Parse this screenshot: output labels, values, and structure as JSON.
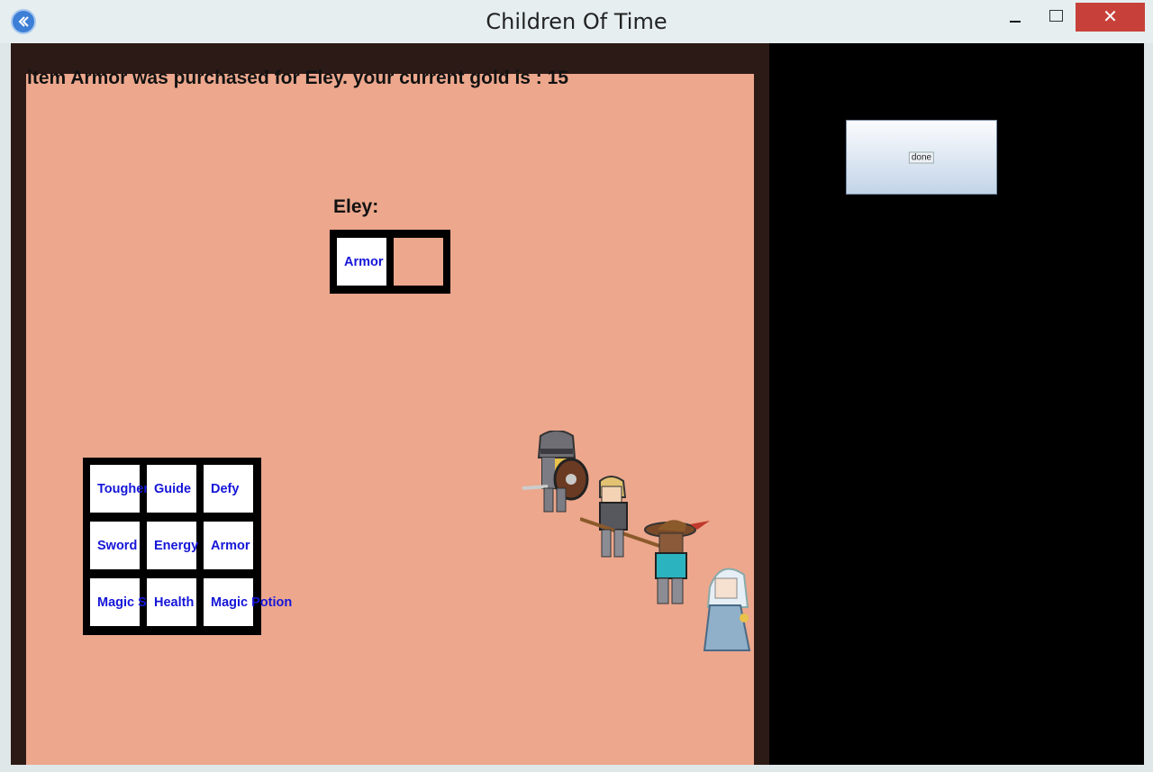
{
  "window": {
    "title": "Children Of Time",
    "close_glyph": "✕"
  },
  "status_message": "item Armor was purchased for Eley. your current gold is : 15",
  "hero": {
    "name": "Eley:",
    "inventory": [
      "Armor",
      ""
    ]
  },
  "shop": {
    "items": [
      [
        "Tougher",
        "Guide",
        "Defy"
      ],
      [
        "Sword",
        "Energy",
        "Armor"
      ],
      [
        "Magic S",
        "Health",
        "Magic Potion"
      ]
    ]
  },
  "done_button": "done",
  "colors": {
    "floor": "#eca78d",
    "frame": "#2c1a16",
    "item_text": "#1515d8",
    "close": "#c7413a"
  },
  "icons": [
    "back-arrow-icon",
    "minimize-icon",
    "maximize-icon",
    "close-icon"
  ]
}
